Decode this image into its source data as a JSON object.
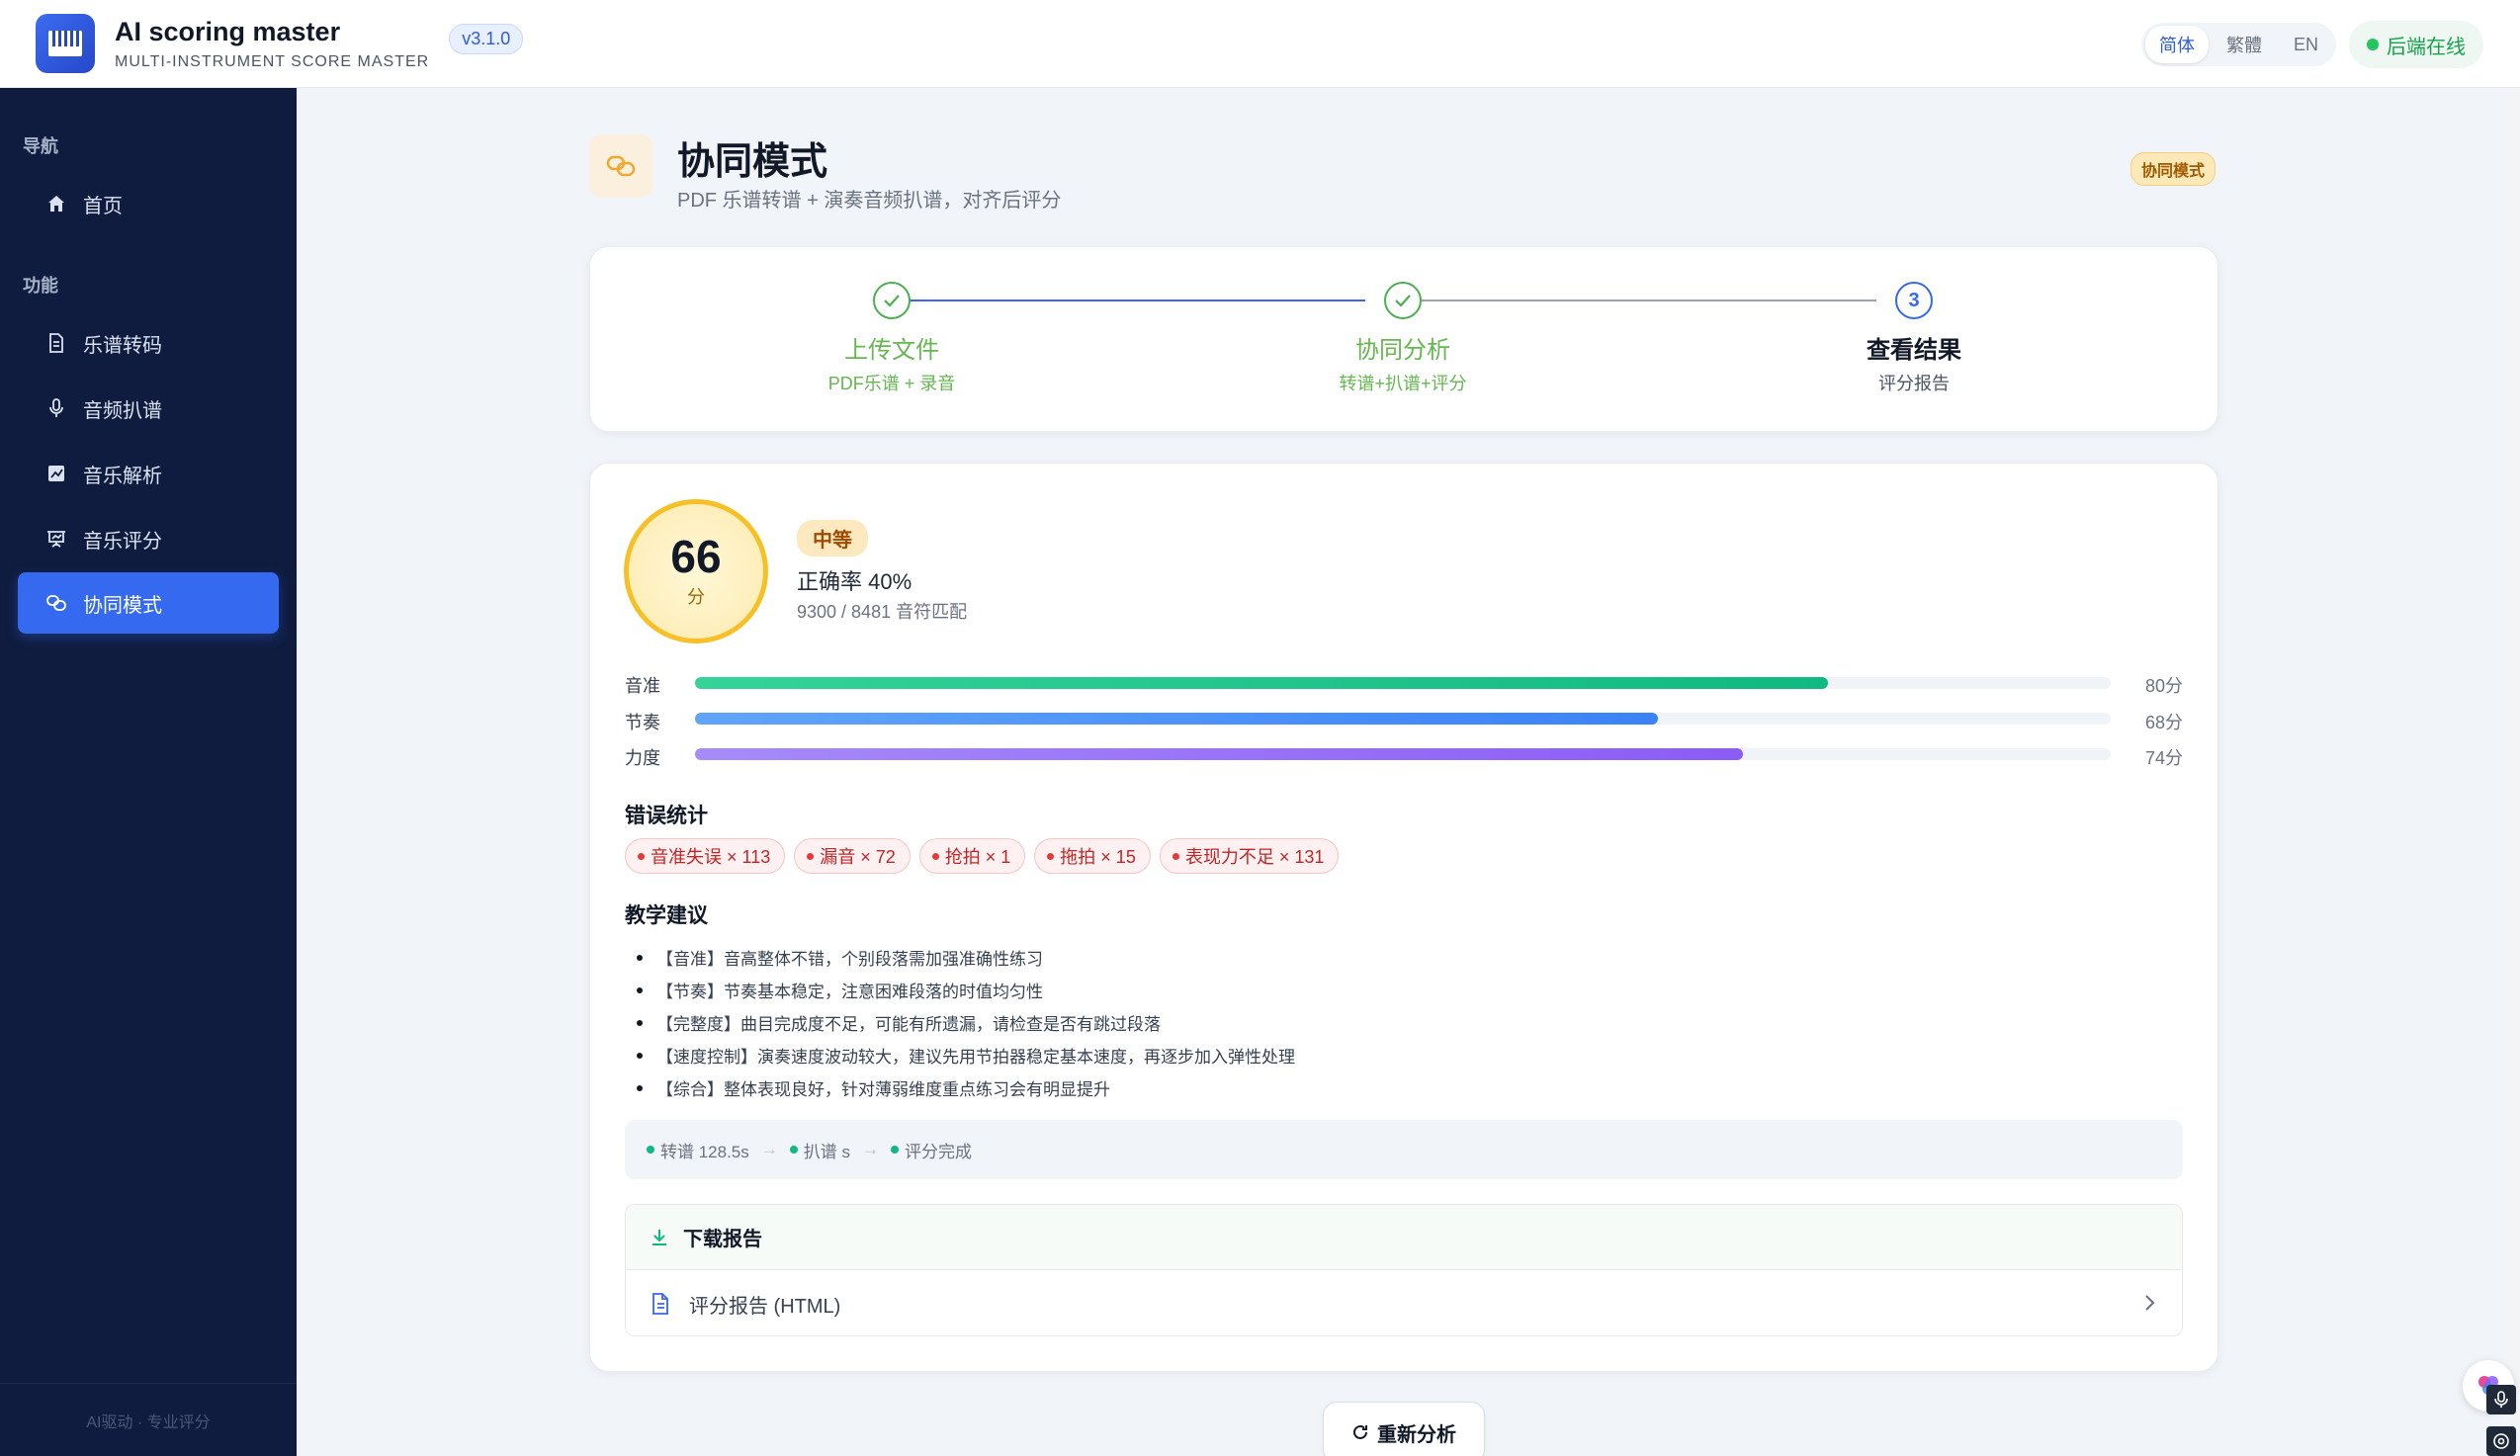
{
  "app": {
    "title": "AI scoring master",
    "subtitle": "MULTI-INSTRUMENT SCORE MASTER",
    "version": "v3.1.0"
  },
  "languages": [
    {
      "label": "简体",
      "active": true
    },
    {
      "label": "繁體",
      "active": false
    },
    {
      "label": "EN",
      "active": false
    }
  ],
  "backend_status": "后端在线",
  "sidebar": {
    "nav_group": "导航",
    "func_group": "功能",
    "items": [
      {
        "label": "首页",
        "icon": "home-icon",
        "active": false
      },
      {
        "label": "乐谱转码",
        "icon": "document-icon",
        "active": false
      },
      {
        "label": "音频扒谱",
        "icon": "microphone-icon",
        "active": false
      },
      {
        "label": "音乐解析",
        "icon": "chart-icon",
        "active": false
      },
      {
        "label": "音乐评分",
        "icon": "presentation-icon",
        "active": false
      },
      {
        "label": "协同模式",
        "icon": "link-icon",
        "active": true
      }
    ],
    "footer": "AI驱动 · 专业评分"
  },
  "page": {
    "title": "协同模式",
    "subtitle": "PDF 乐谱转谱 + 演奏音频扒谱，对齐后评分",
    "badge": "协同模式"
  },
  "steps": [
    {
      "title": "上传文件",
      "desc": "PDF乐谱 + 录音",
      "state": "done"
    },
    {
      "title": "协同分析",
      "desc": "转谱+扒谱+评分",
      "state": "done"
    },
    {
      "title": "查看结果",
      "desc": "评分报告",
      "state": "current",
      "number": "3"
    }
  ],
  "score": {
    "value": "66",
    "unit": "分",
    "level": "中等",
    "accuracy": "正确率 40%",
    "match": "9300 / 8481 音符匹配"
  },
  "metrics": [
    {
      "label": "音准",
      "value": 80,
      "value_text": "80分",
      "color_from": "#34d399",
      "color_to": "#10b981"
    },
    {
      "label": "节奏",
      "value": 68,
      "value_text": "68分",
      "color_from": "#60a5fa",
      "color_to": "#3b82f6"
    },
    {
      "label": "力度",
      "value": 74,
      "value_text": "74分",
      "color_from": "#a78bfa",
      "color_to": "#8b5cf6"
    }
  ],
  "errors": {
    "title": "错误统计",
    "items": [
      "音准失误 × 113",
      "漏音 × 72",
      "抢拍 × 1",
      "拖拍 × 15",
      "表现力不足 × 131"
    ]
  },
  "advice": {
    "title": "教学建议",
    "items": [
      "【音准】音高整体不错，个别段落需加强准确性练习",
      "【节奏】节奏基本稳定，注意困难段落的时值均匀性",
      "【完整度】曲目完成度不足，可能有所遗漏，请检查是否有跳过段落",
      "【速度控制】演奏速度波动较大，建议先用节拍器稳定基本速度，再逐步加入弹性处理",
      "【综合】整体表现良好，针对薄弱维度重点练习会有明显提升"
    ]
  },
  "timeline": [
    "转谱 128.5s",
    "扒谱 s",
    "评分完成"
  ],
  "download": {
    "title": "下载报告",
    "file": "评分报告 (HTML)"
  },
  "reanalyze_label": "重新分析"
}
